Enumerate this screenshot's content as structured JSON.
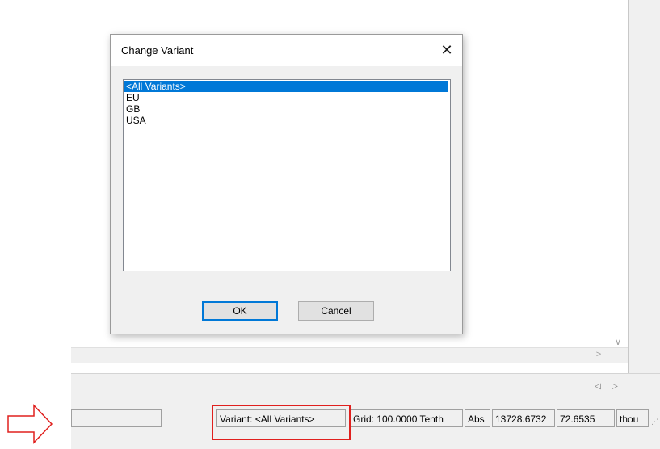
{
  "dialog": {
    "title": "Change Variant",
    "close_glyph": "✕",
    "list_items": [
      "<All Variants>",
      "EU",
      "GB",
      "USA"
    ],
    "selected_index": 0,
    "ok_label": "OK",
    "cancel_label": "Cancel"
  },
  "status_bar": {
    "variant": "Variant: <All Variants>",
    "grid": "Grid: 100.0000 Tenth",
    "abs": "Abs",
    "x": "13728.6732",
    "y": "72.6535",
    "units": "thou"
  },
  "glyphs": {
    "scroll_down": "∨",
    "scroll_right": ">",
    "prev": "◁",
    "next": "▷",
    "grip": "⋰"
  },
  "colors": {
    "selection": "#0078d7",
    "annotation": "#e0201e"
  }
}
